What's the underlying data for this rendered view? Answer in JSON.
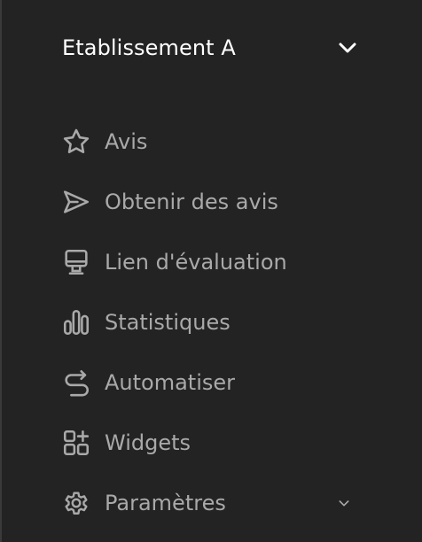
{
  "colors": {
    "background": "#232323",
    "header_text": "#ffffff",
    "menu_text": "#a9a9a9",
    "icon_stroke": "#a9a9a9"
  },
  "establishment": {
    "title": "Etablissement A",
    "chevron_icon": "chevron-down-icon"
  },
  "menu": {
    "items": [
      {
        "label": "Avis",
        "icon": "star-icon"
      },
      {
        "label": "Obtenir des avis",
        "icon": "send-icon"
      },
      {
        "label": "Lien d'évaluation",
        "icon": "monitor-icon"
      },
      {
        "label": "Statistiques",
        "icon": "bar-chart-icon"
      },
      {
        "label": "Automatiser",
        "icon": "loop-icon"
      },
      {
        "label": "Widgets",
        "icon": "widgets-icon"
      },
      {
        "label": "Paramètres",
        "icon": "gear-icon",
        "chevron_icon": "chevron-down-icon"
      }
    ]
  }
}
